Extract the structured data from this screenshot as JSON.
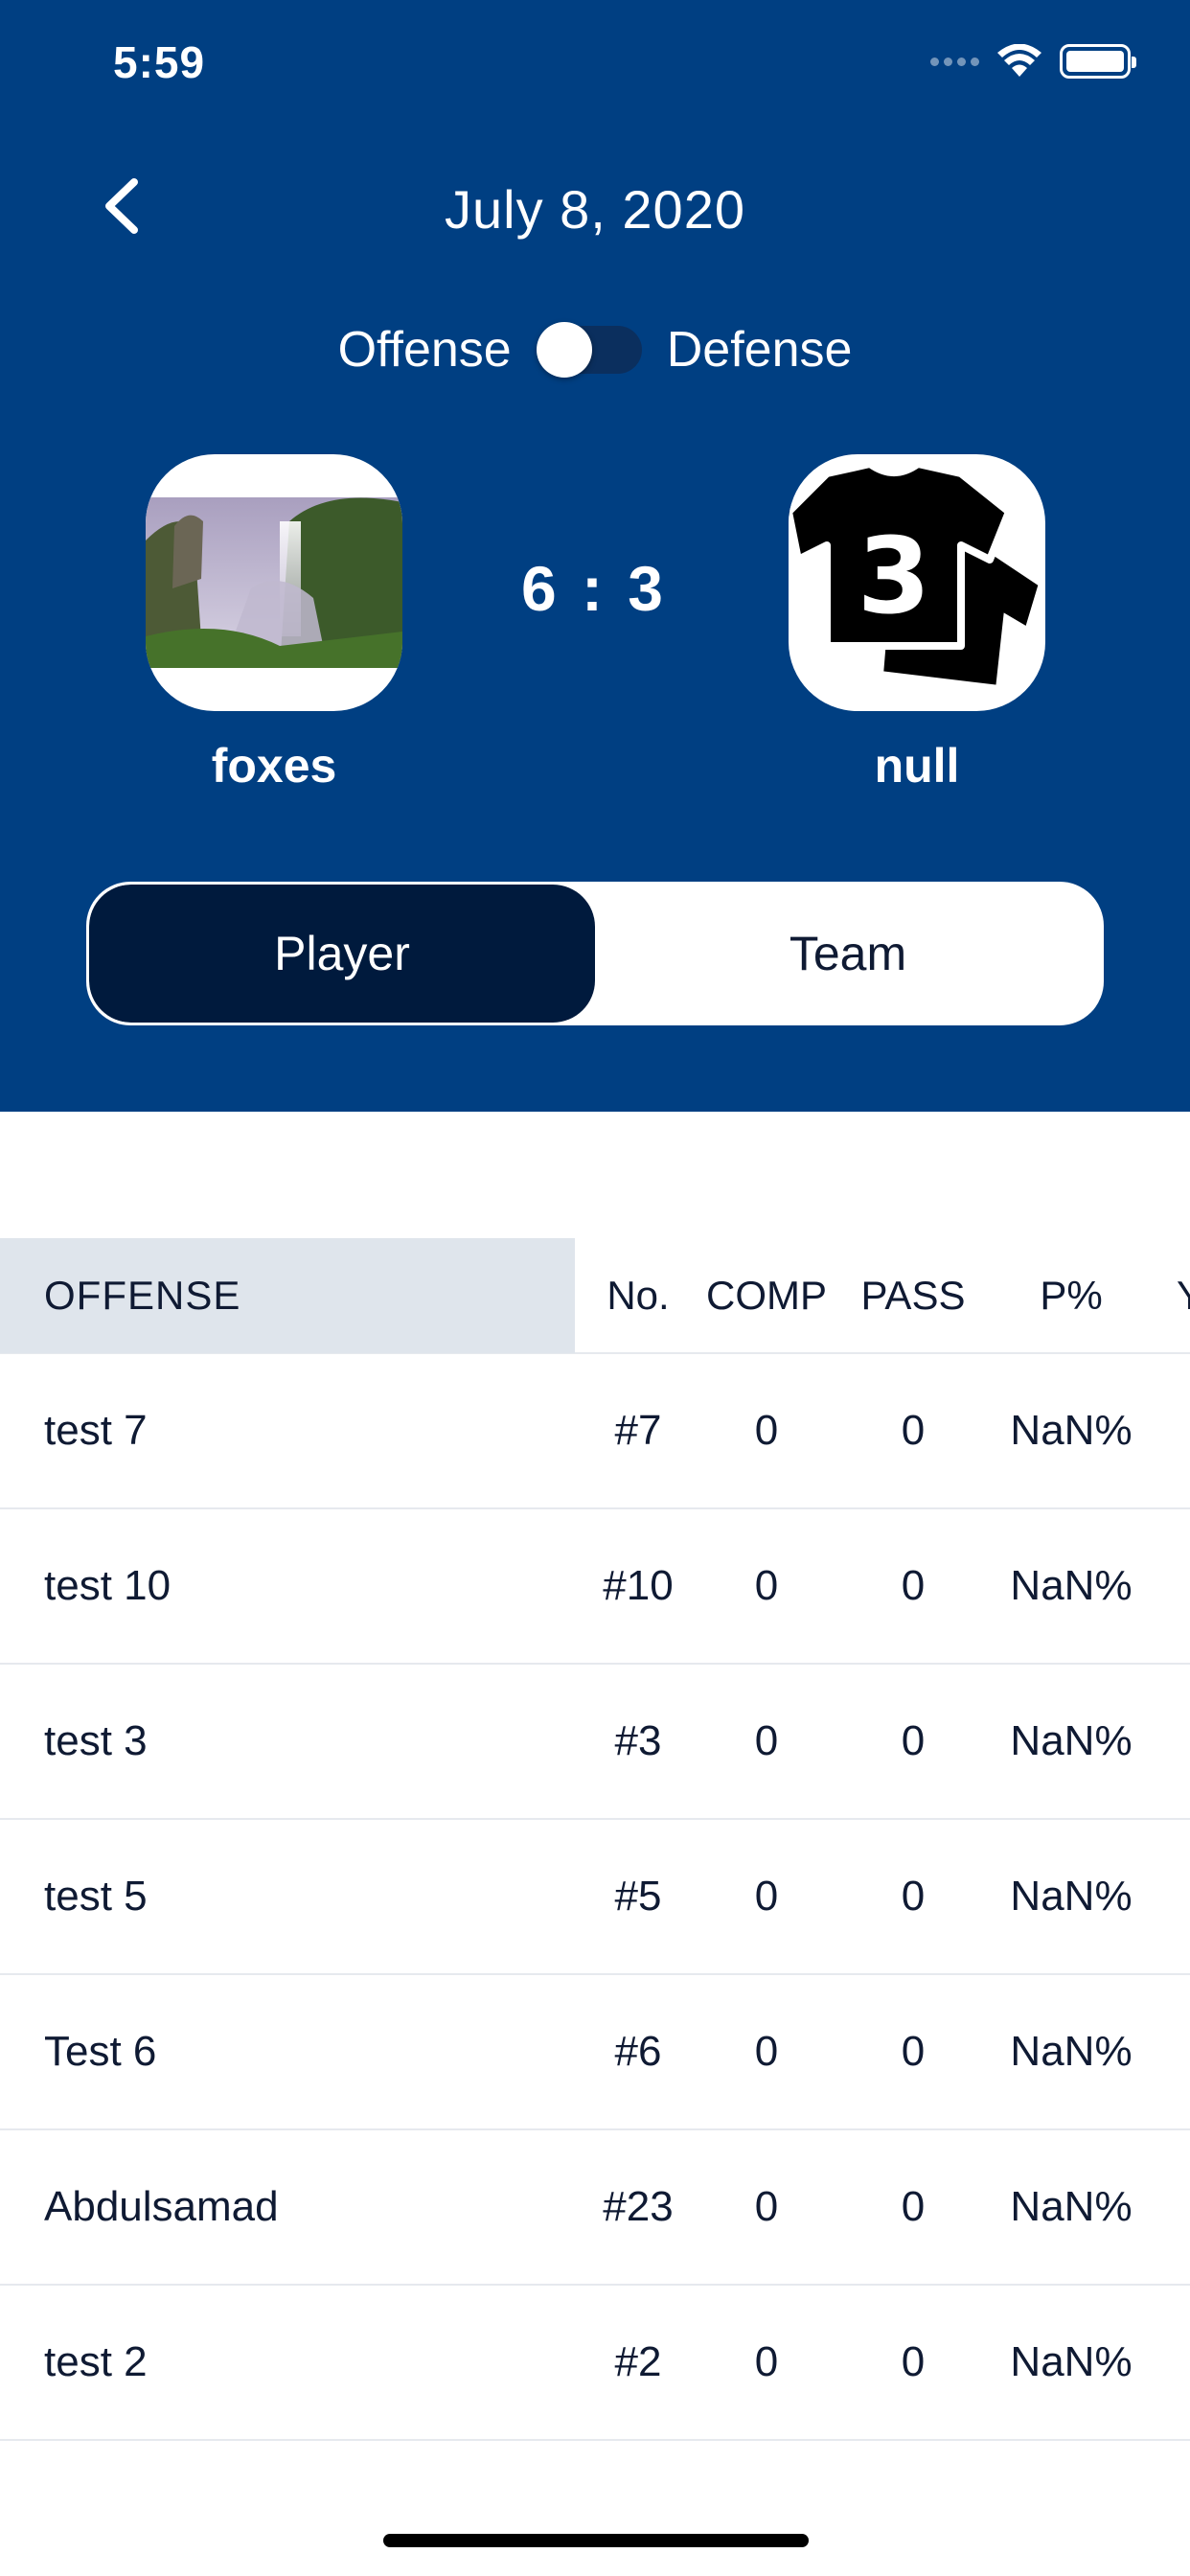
{
  "status_bar": {
    "time": "5:59"
  },
  "header": {
    "title": "July 8, 2020",
    "toggle": {
      "left_label": "Offense",
      "right_label": "Defense",
      "state": "offense"
    },
    "home_team": {
      "name": "foxes",
      "logo": "waterfall-photo"
    },
    "away_team": {
      "name": "null",
      "logo": "jersey-number-3-icon"
    },
    "score": "6 : 3"
  },
  "segmented": {
    "player_label": "Player",
    "team_label": "Team",
    "active": "Player"
  },
  "table": {
    "columns": [
      "OFFENSE",
      "No.",
      "COMP",
      "PASS",
      "P%",
      "Y"
    ],
    "rows": [
      {
        "name": "test 7",
        "no": "#7",
        "comp": "0",
        "pass": "0",
        "pct": "NaN%"
      },
      {
        "name": "test 10",
        "no": "#10",
        "comp": "0",
        "pass": "0",
        "pct": "NaN%"
      },
      {
        "name": "test 3",
        "no": "#3",
        "comp": "0",
        "pass": "0",
        "pct": "NaN%"
      },
      {
        "name": "test 5",
        "no": "#5",
        "comp": "0",
        "pass": "0",
        "pct": "NaN%"
      },
      {
        "name": "Test 6",
        "no": "#6",
        "comp": "0",
        "pass": "0",
        "pct": "NaN%"
      },
      {
        "name": "Abdulsamad",
        "no": "#23",
        "comp": "0",
        "pass": "0",
        "pct": "NaN%"
      },
      {
        "name": "test 2",
        "no": "#2",
        "comp": "0",
        "pass": "0",
        "pct": "NaN%"
      }
    ]
  }
}
